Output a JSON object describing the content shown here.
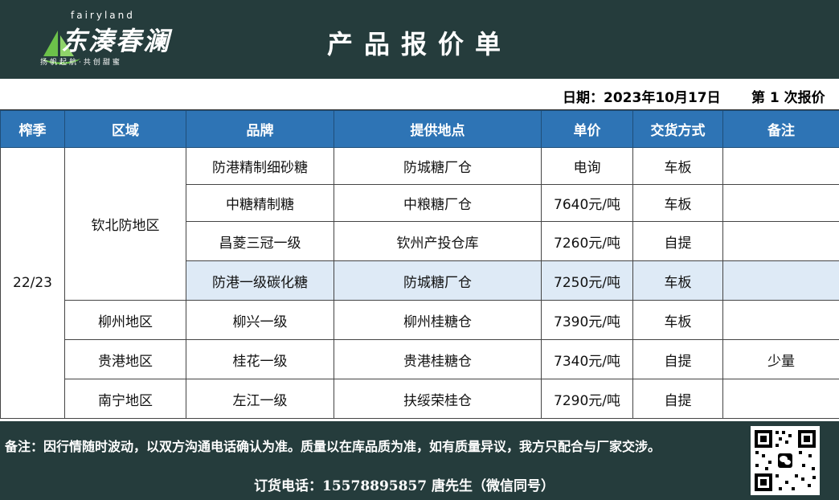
{
  "brand": {
    "en": "fairyland",
    "cn": "东湊春澜",
    "slogan": "扬帆起航·共创甜蜜"
  },
  "title": "产品报价单",
  "date_label": "日期：2023年10月17日",
  "count_label": "第 1 次报价",
  "columns": [
    "榨季",
    "区域",
    "品牌",
    "提供地点",
    "单价",
    "交货方式",
    "备注"
  ],
  "season": "22/23",
  "regions": [
    "钦北防地区",
    "柳州地区",
    "贵港地区",
    "南宁地区"
  ],
  "rows": [
    {
      "brand": "防港精制细砂糖",
      "location": "防城糖厂仓",
      "price": "电询",
      "delivery": "车板",
      "remark": ""
    },
    {
      "brand": "中糖精制糖",
      "location": "中粮糖厂仓",
      "price": "7640元/吨",
      "delivery": "车板",
      "remark": ""
    },
    {
      "brand": "昌菱三冠一级",
      "location": "钦州产投仓库",
      "price": "7260元/吨",
      "delivery": "自提",
      "remark": ""
    },
    {
      "brand": "防港一级碳化糖",
      "location": "防城糖厂仓",
      "price": "7250元/吨",
      "delivery": "车板",
      "remark": ""
    },
    {
      "brand": "柳兴一级",
      "location": "柳州桂糖仓",
      "price": "7390元/吨",
      "delivery": "车板",
      "remark": ""
    },
    {
      "brand": "桂花一级",
      "location": "贵港桂糖仓",
      "price": "7340元/吨",
      "delivery": "自提",
      "remark": "少量"
    },
    {
      "brand": "左江一级",
      "location": "扶绥荣桂仓",
      "price": "7290元/吨",
      "delivery": "自提",
      "remark": ""
    }
  ],
  "footer": {
    "note": "备注：因行情随时波动，以双方沟通电话确认为准。质量以在库品质为准，如有质量异议，我方只配合与厂家交涉。",
    "phone": "订货电话：15578895857 唐先生（微信同号）"
  },
  "colors": {
    "header_bg": "#253c3c",
    "table_header_bg": "#2e74b5",
    "highlight_row": "#deeaf6",
    "logo_green": "#6cc24a"
  },
  "icons": [
    "sail-logo-icon",
    "qr-code-icon",
    "wechat-icon"
  ]
}
